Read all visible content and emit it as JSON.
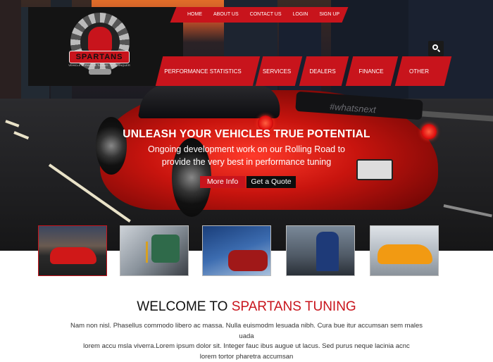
{
  "top_nav": [
    {
      "label": "HOME"
    },
    {
      "label": "ABOUT US"
    },
    {
      "label": "CONTACT US"
    },
    {
      "label": "LOGIN"
    },
    {
      "label": "SIGN UP"
    }
  ],
  "main_nav": [
    {
      "label": "PERFORMANCE STATISTICS"
    },
    {
      "label": "SERVICES"
    },
    {
      "label": "DEALERS"
    },
    {
      "label": "FINANCE"
    },
    {
      "label": "OTHER"
    }
  ],
  "logo": {
    "name": "SPARTANS",
    "tagline": "VEHICLE SERVICE & TUNING · WE CONQUER GAS & DIESEL"
  },
  "car_text": "#whatsnext",
  "hero": {
    "headline": "UNLEASH YOUR VEHICLES TRUE POTENTIAL",
    "subline_1": "Ongoing development work on our Rolling Road to",
    "subline_2": "provide the very best in performance tuning",
    "more_info": "More Info",
    "get_quote": "Get a Quote"
  },
  "thumbnails": [
    {
      "name": "red-sports-car"
    },
    {
      "name": "oil-change"
    },
    {
      "name": "car-wash"
    },
    {
      "name": "mechanic-engine"
    },
    {
      "name": "orange-sports-car"
    }
  ],
  "welcome": {
    "title_plain": "WELCOME TO ",
    "title_accent": "SPARTANS TUNING",
    "line_1": "Nam non nisl. Phasellus commodo libero ac massa. Nulla euismodm lesuada nibh. Cura bue itur accumsan sem males uada",
    "line_2": "lorem accu msla viverra.Lorem ipsum dolor sit. Integer fauc ibus augue ut lacus. Sed purus neque lacinia acnc",
    "line_3": "lorem tortor pharetra accumsan"
  },
  "colors": {
    "accent": "#c8141c",
    "header_bg": "#141414"
  }
}
